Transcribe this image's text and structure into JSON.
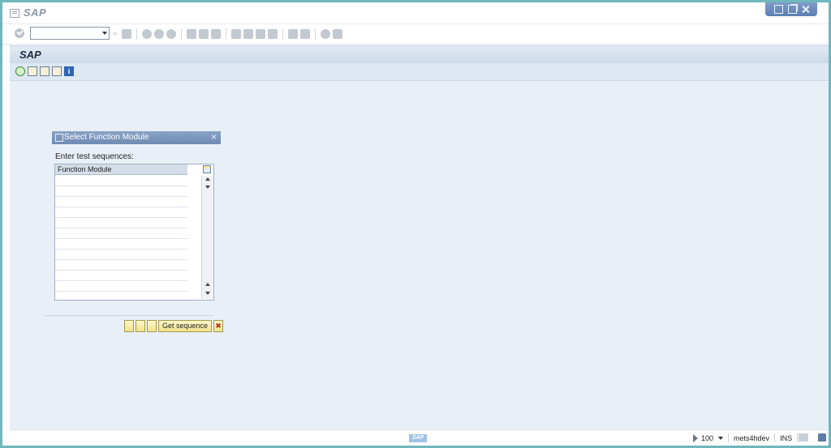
{
  "window": {
    "title": "SAP"
  },
  "toolbar": {
    "command_value": ""
  },
  "app": {
    "title": "SAP"
  },
  "dialog": {
    "title": "Select Function Module",
    "label": "Enter test sequences:",
    "column_header": "Function Module",
    "rows": [
      "",
      "",
      "",
      "",
      "",
      "",
      "",
      "",
      "",
      "",
      ""
    ],
    "get_sequence_label": "Get sequence"
  },
  "status": {
    "zoom": "100",
    "system": "mets4hdev",
    "mode": "INS",
    "logo": "SAP"
  },
  "colors": {
    "header_blue": "#cbd9e8",
    "dialog_header": "#6f8bb3",
    "work_area": "#e8eff6",
    "button_yellow": "#f1e28a"
  }
}
